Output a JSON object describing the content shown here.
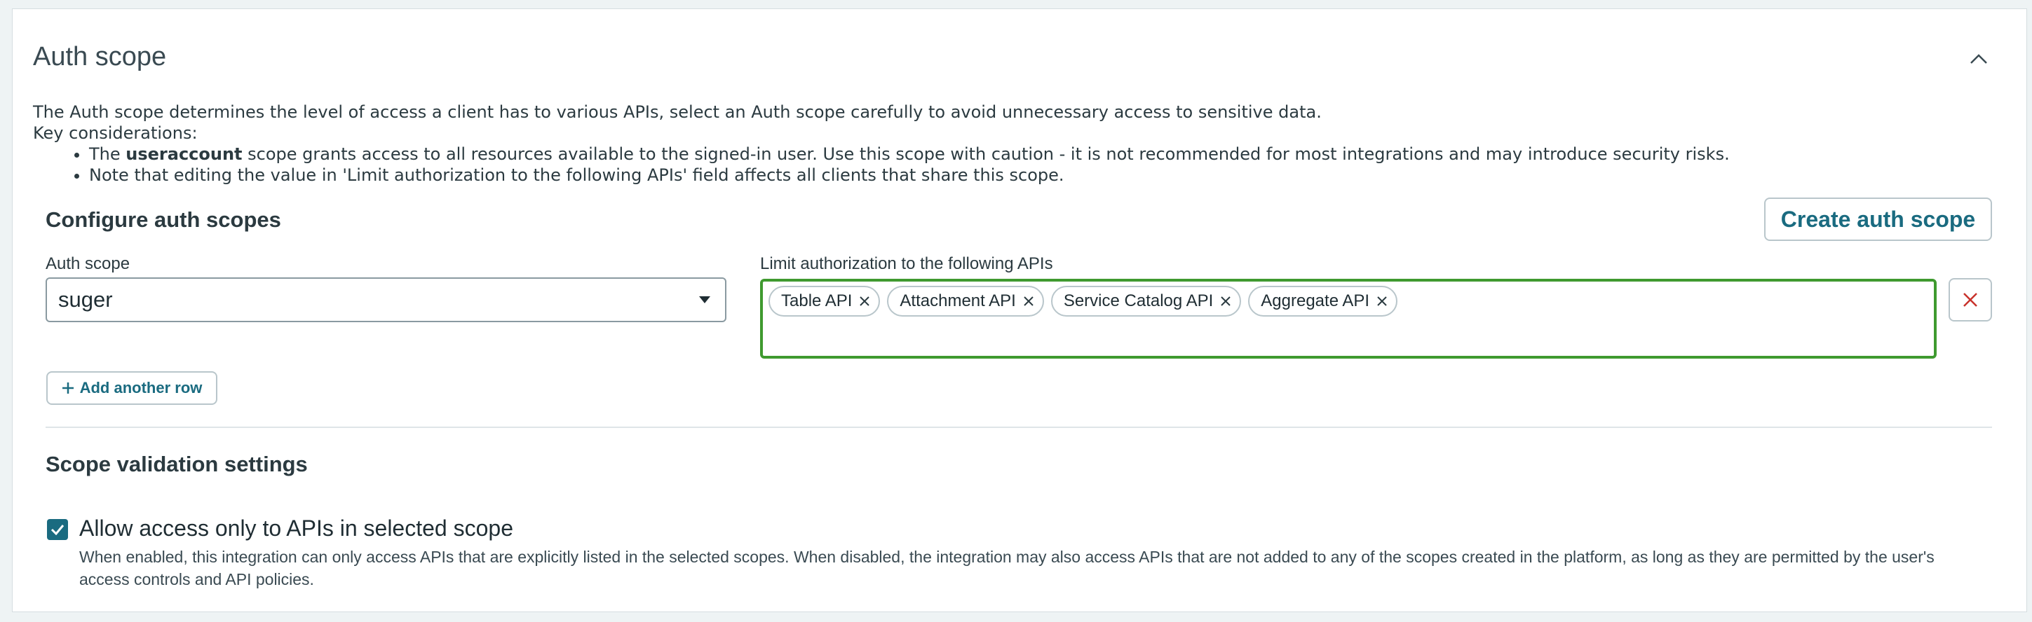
{
  "section": {
    "title": "Auth scope",
    "description": {
      "intro": "The Auth scope determines the level of access a client has to various APIs, select an Auth scope carefully to avoid unnecessary access to sensitive data.",
      "key_considerations": "Key considerations:",
      "bullet1_prefix": "The ",
      "bullet1_bold": "useraccount",
      "bullet1_suffix": " scope grants access to all resources available to the signed-in user. Use this scope with caution - it is not recommended for most integrations and may introduce security risks.",
      "bullet2": "Note that editing the value in 'Limit authorization to the following APIs' field affects all clients that share this scope."
    }
  },
  "configure": {
    "heading": "Configure auth scopes",
    "create_button": "Create auth scope",
    "auth_scope_label": "Auth scope",
    "auth_scope_value": "suger",
    "limit_label": "Limit authorization to the following APIs",
    "apis": [
      "Table API",
      "Attachment API",
      "Service Catalog API",
      "Aggregate API"
    ],
    "add_row": "Add another row"
  },
  "validation": {
    "heading": "Scope validation settings",
    "checkbox_checked": true,
    "checkbox_label": "Allow access only to APIs in selected scope",
    "checkbox_desc": "When enabled, this integration can only access APIs that are explicitly listed in the selected scopes. When disabled, the integration may also access APIs that are not added to any of the scopes created in the platform, as long as they are permitted by the user's access controls and API policies."
  },
  "colors": {
    "accent": "#1a6b80",
    "focus_border": "#3f9a2f",
    "remove_icon": "#c8322b"
  }
}
